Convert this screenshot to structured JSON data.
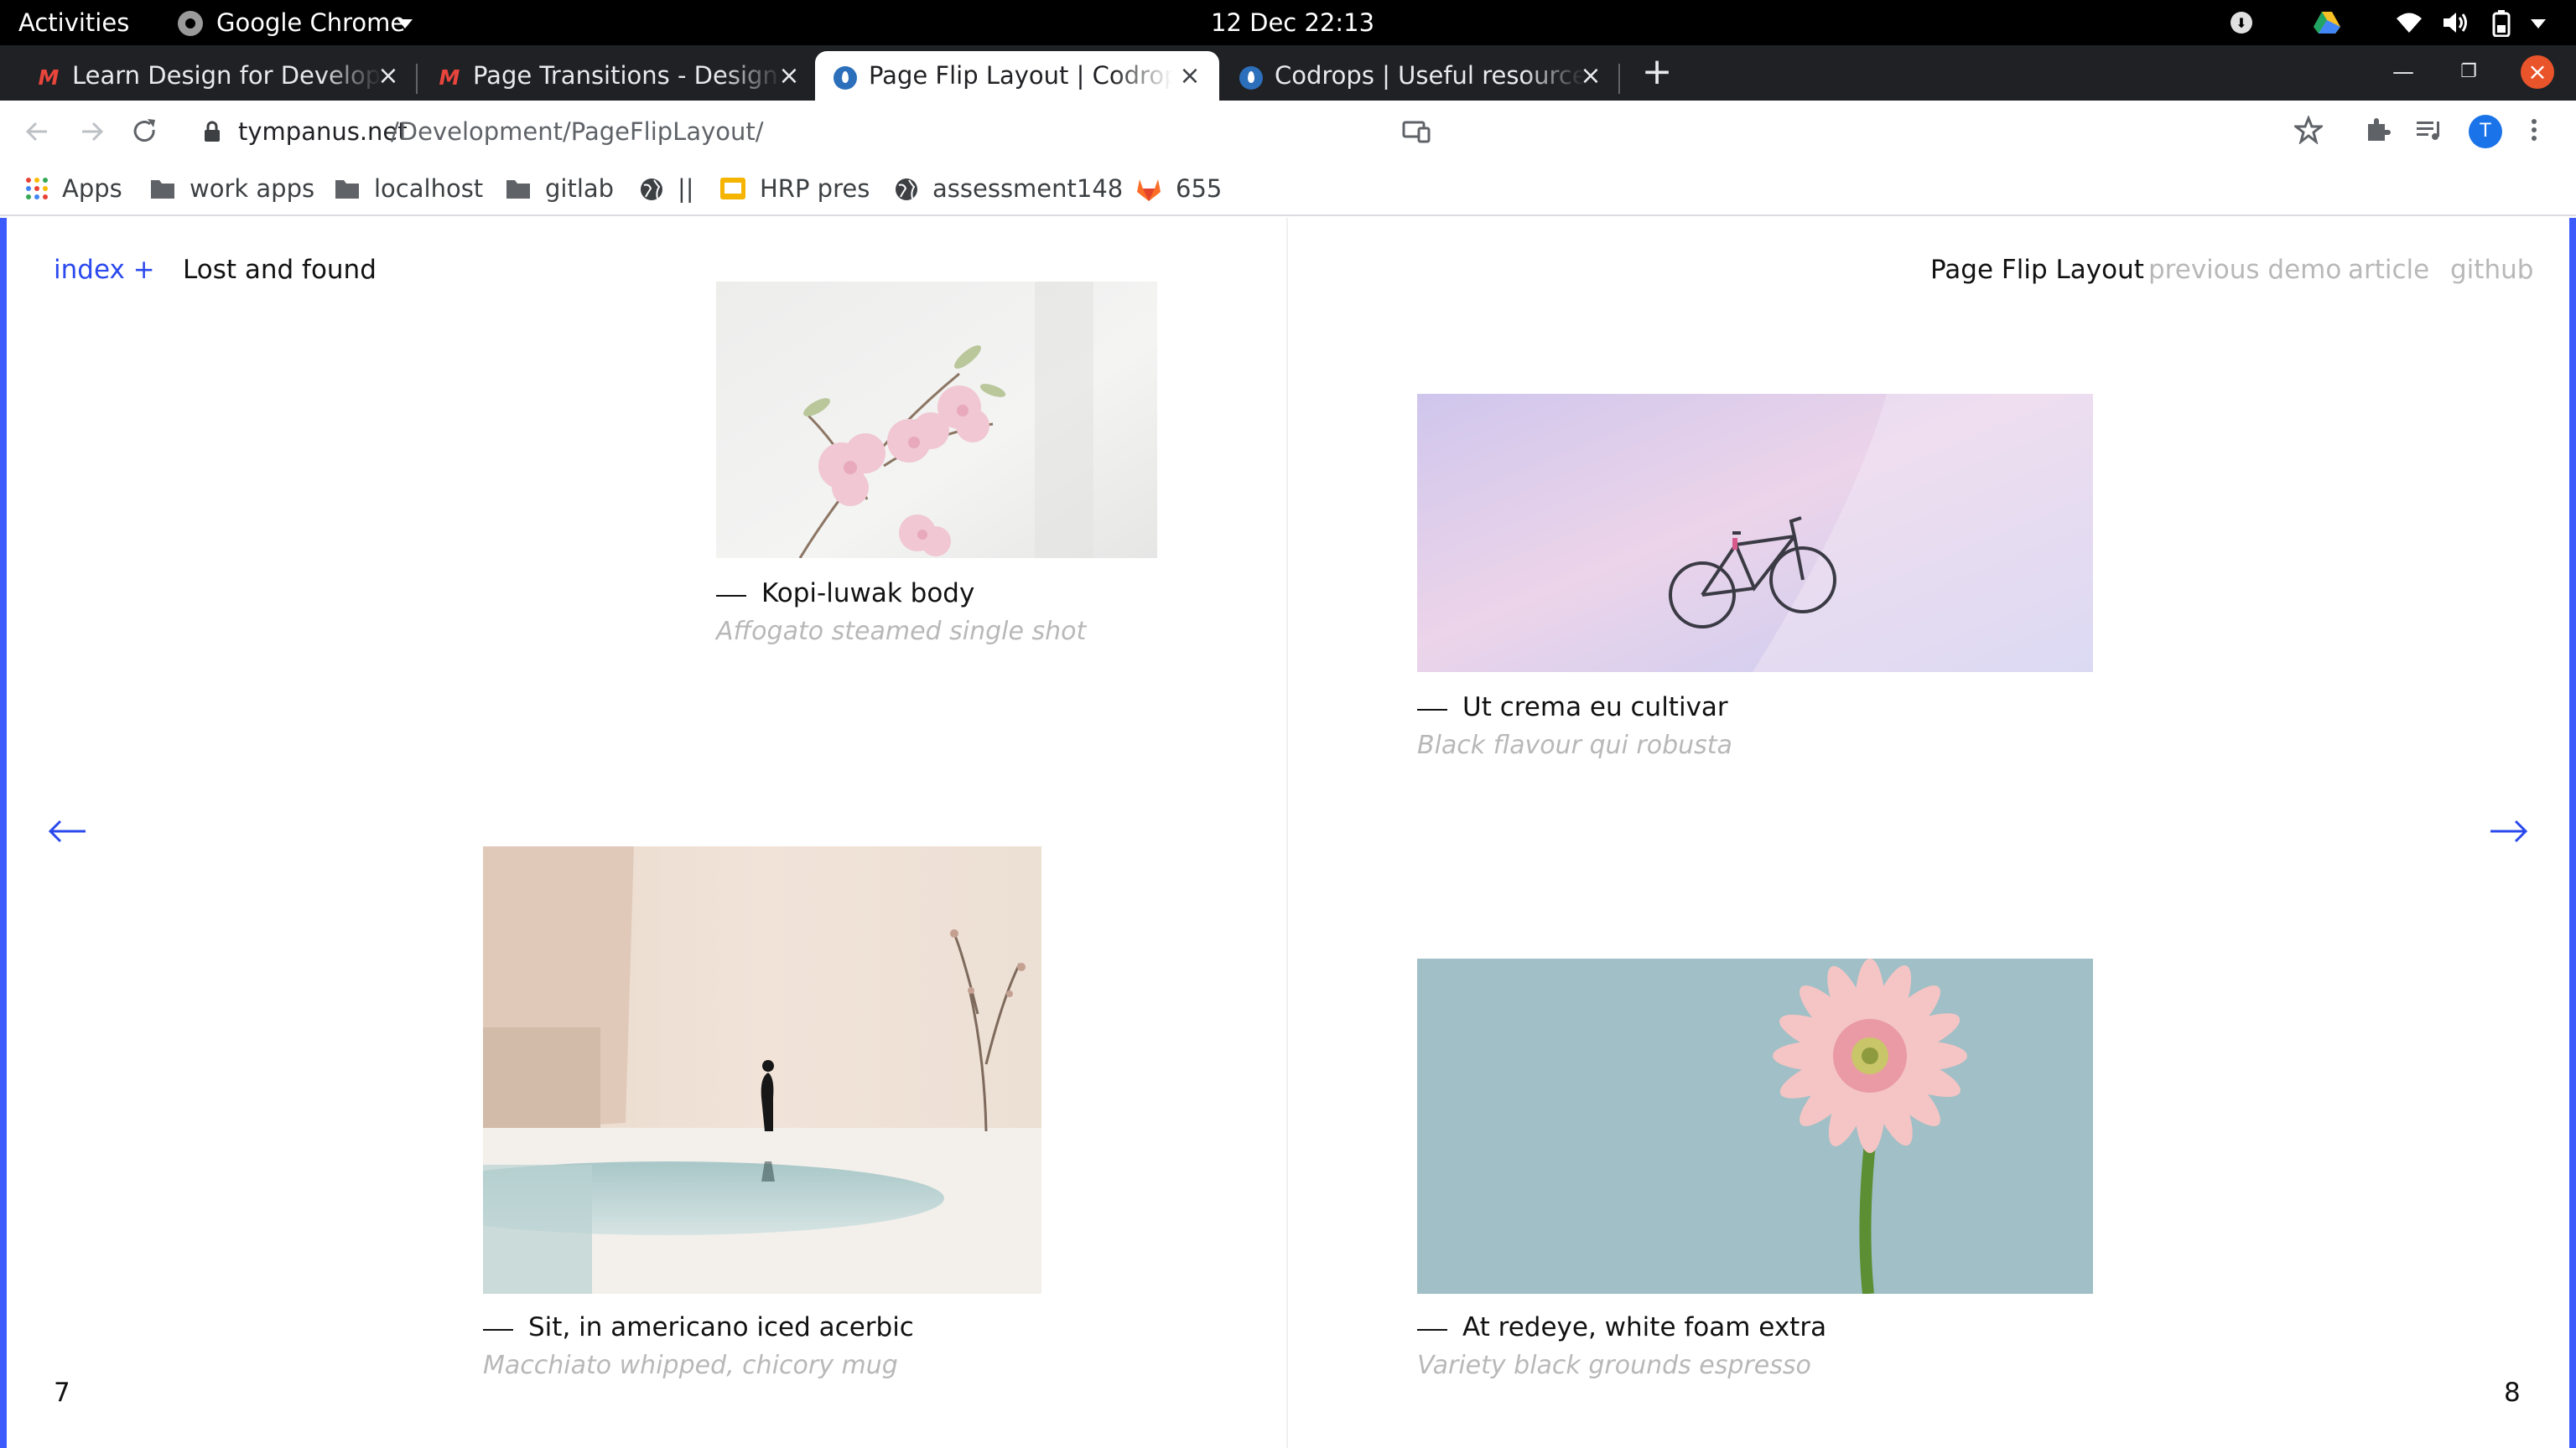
{
  "system": {
    "activities": "Activities",
    "app_name": "Google Chrome",
    "clock": "12 Dec  22:13"
  },
  "tabs": [
    {
      "title": "Learn Design for Developers",
      "favicon": "modern-m-favicon",
      "active": false
    },
    {
      "title": "Page Transitions - Design",
      "favicon": "modern-m-favicon",
      "active": false
    },
    {
      "title": "Page Flip Layout | Codrops",
      "favicon": "codrops-favicon",
      "active": true
    },
    {
      "title": "Codrops | Useful resources",
      "favicon": "codrops-favicon",
      "active": false
    }
  ],
  "toolbar": {
    "url_domain": "tympanus.net",
    "url_path": "/Development/PageFlipLayout/",
    "avatar_letter": "T"
  },
  "bookmarks": [
    {
      "label": "Apps",
      "icon": "apps-grid-icon"
    },
    {
      "label": "work apps",
      "icon": "folder-icon"
    },
    {
      "label": "localhost",
      "icon": "folder-icon"
    },
    {
      "label": "gitlab",
      "icon": "folder-icon"
    },
    {
      "label": "||",
      "icon": "globe-icon"
    },
    {
      "label": "HRP pres",
      "icon": "slides-icon"
    },
    {
      "label": "assessment148",
      "icon": "globe-icon"
    },
    {
      "label": "655",
      "icon": "gitlab-icon"
    }
  ],
  "page": {
    "nav": {
      "index_label": "index +",
      "title": "Lost and found",
      "demo_name": "Page Flip Layout",
      "previous_demo": "previous demo",
      "article": "article",
      "github": "github"
    },
    "left_page": {
      "number": "7",
      "items": [
        {
          "title": "Kopi-luwak body",
          "subtitle": "Affogato steamed single shot",
          "image": "cherry-blossom-photo"
        },
        {
          "title": "Sit, in americano iced acerbic",
          "subtitle": "Macchiato whipped, chicory mug",
          "image": "woman-by-pool-photo"
        }
      ]
    },
    "right_page": {
      "number": "8",
      "items": [
        {
          "title": "Ut crema eu cultivar",
          "subtitle": "Black flavour qui robusta",
          "image": "pink-bicycle-photo"
        },
        {
          "title": "At redeye, white foam extra",
          "subtitle": "Variety black grounds espresso",
          "image": "pink-gerbera-photo"
        }
      ]
    }
  },
  "colors": {
    "accent_blue": "#2a49ee",
    "edge_blue": "#3b5bfd",
    "muted_text": "#b8b8b8",
    "chrome_tabstrip": "#202124"
  }
}
